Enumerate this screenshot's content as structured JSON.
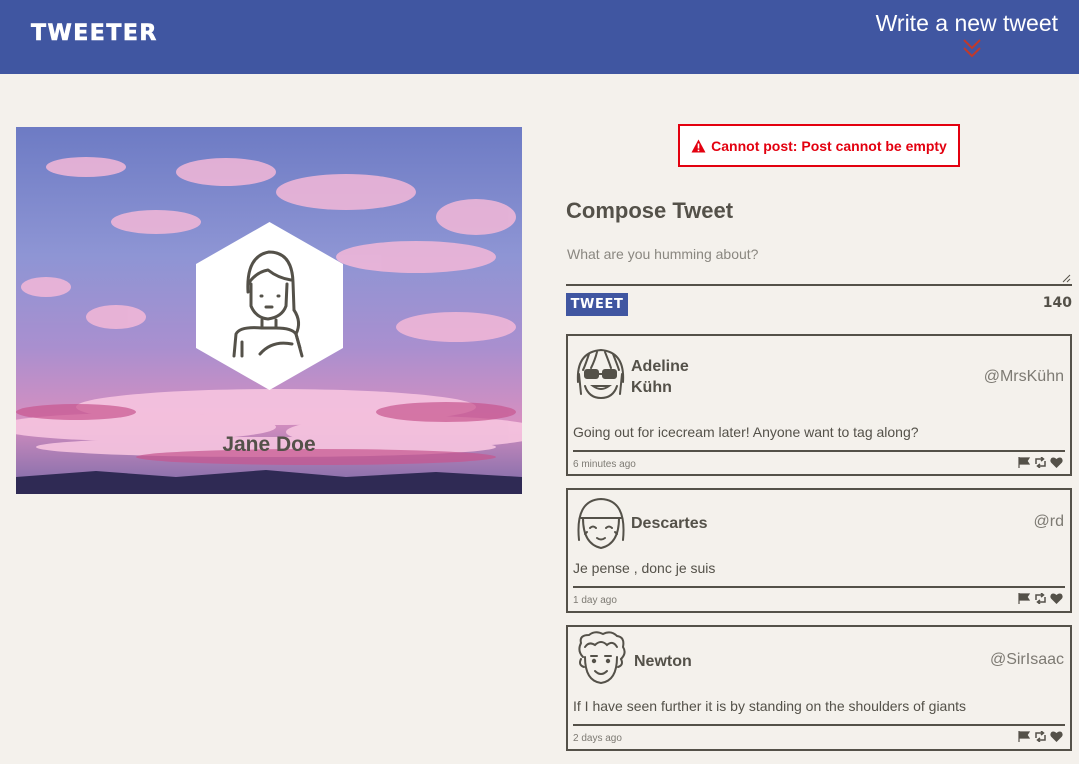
{
  "header": {
    "brand": "TWEETER",
    "write_new": "Write a new tweet"
  },
  "profile": {
    "name": "Jane Doe"
  },
  "error": {
    "message": "Cannot post: Post cannot be empty"
  },
  "compose": {
    "title": "Compose Tweet",
    "placeholder": "What are you humming about?",
    "button_label": "TWEET",
    "counter": "140"
  },
  "tweets": [
    {
      "name_line1": "Adeline",
      "name_line2": "Kühn",
      "handle": "@MrsKühn",
      "content": "Going out for icecream later! Anyone want to tag along?",
      "time": "6 minutes ago"
    },
    {
      "name": "Descartes",
      "handle": "@rd",
      "content": "Je pense , donc je suis",
      "time": "1 day ago"
    },
    {
      "name": "Newton",
      "handle": "@SirIsaac",
      "content": "If I have seen further it is by standing on the shoulders of giants",
      "time": "2 days ago"
    }
  ],
  "colors": {
    "navbar": "#4056a1",
    "background": "#f4f1ec",
    "text": "#545149",
    "error": "#e3000f"
  }
}
